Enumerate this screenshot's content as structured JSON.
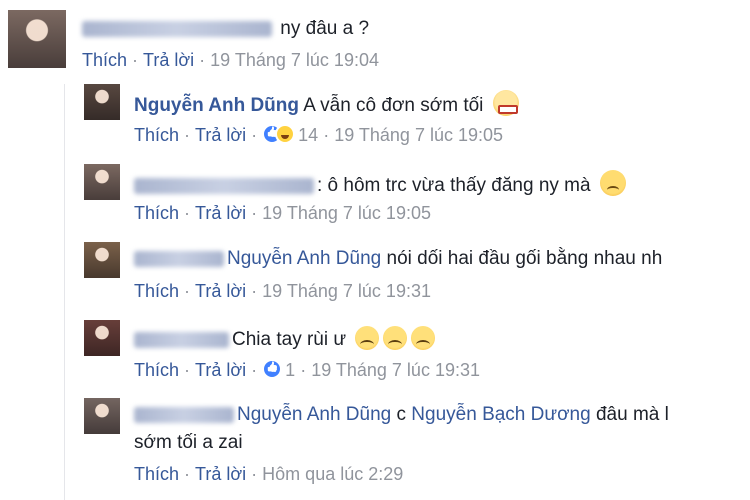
{
  "comments": [
    {
      "author": "",
      "text": "ny đâu a ?",
      "actions": {
        "like": "Thích",
        "reply": "Trả lời"
      },
      "time": "19 Tháng 7 lúc 19:04"
    }
  ],
  "replies": [
    {
      "author": "Nguyễn Anh Dũng",
      "text": "A vẫn cô đơn sớm tối",
      "emoji": "angry-face",
      "actions": {
        "like": "Thích",
        "reply": "Trả lời"
      },
      "reactions": {
        "icons": [
          "like-icon",
          "haha-icon"
        ],
        "count": "14"
      },
      "time": "19 Tháng 7 lúc 19:05"
    },
    {
      "author": "",
      "text": ": ô hôm trc vừa thấy đăng ny mà",
      "emoji": "sad-face",
      "actions": {
        "like": "Thích",
        "reply": "Trả lời"
      },
      "time": "19 Tháng 7 lúc 19:05"
    },
    {
      "author": "",
      "mention": "Nguyễn Anh Dũng",
      "text": "nói dối hai đầu gối bằng nhau nh",
      "actions": {
        "like": "Thích",
        "reply": "Trả lời"
      },
      "time": "19 Tháng 7 lúc 19:31"
    },
    {
      "author": "",
      "text": "Chia tay rùi ư",
      "emoji": "frown-face",
      "emoji_count": 3,
      "actions": {
        "like": "Thích",
        "reply": "Trả lời"
      },
      "reactions": {
        "icons": [
          "like-icon"
        ],
        "count": "1"
      },
      "time": "19 Tháng 7 lúc 19:31"
    },
    {
      "author": "",
      "mention": "Nguyễn Anh Dũng",
      "text": "c",
      "mention2": "Nguyễn Bạch Dương",
      "text2": "đâu mà l",
      "text3": "sớm tối a zai",
      "actions": {
        "like": "Thích",
        "reply": "Trả lời"
      },
      "time": "Hôm qua lúc 2:29"
    }
  ],
  "colors": {
    "link": "#365899",
    "meta": "#90949c",
    "text": "#1d2129",
    "like": "#4080ff"
  }
}
